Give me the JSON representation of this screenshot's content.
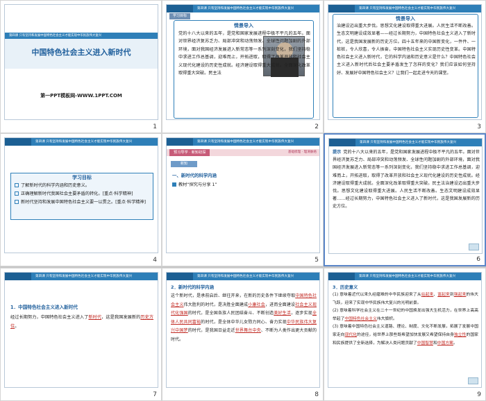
{
  "slides": [
    {
      "num": "1",
      "subtitle": "第四课 只有坚持和发展中国特色社会主义才能实现中华民族伟大复兴",
      "title": "中国特色社会主义进入新时代",
      "footer": "第一PPT模板网-WWW.1PPT.COM"
    },
    {
      "num": "2",
      "header": "第四课 只有坚持和发展中国特色社会主义才能实现中华民族伟大复兴",
      "section_tag": "学习目标",
      "box_title": "情景导入",
      "paragraph": "党的十八大以来的五年，是党和国家发展进程中极不平凡的五年。面对世界经济复苏乏力、局部冲突和动荡频发、全球性问题加剧的外部环境，面对我国经济发展进入新常态等一系列深刻变化，我们坚持稳中求进工作总基调，迎难而上，开拓进取，取得了改革开放和社会主义现代化建设的历史性成就。经济建设取得重大成就。全面深化改革取得重大突破。民主法"
    },
    {
      "num": "3",
      "header": "第四课 只有坚持和发展中国特色社会主义才能实现中华民族伟大复兴",
      "box_title": "情景导入",
      "paragraph": "治建设迈出重大步伐。思想文化建设取得重大进展。人民生活不断改善。生态文明建设成效显著——经过长期努力，中国特色社会主义进入了新时代，这是我国发展新的历史方位。四十五年来的中国新变化，一件件、一桩桩，令人欣喜，令人振奋，中国特色社会主义实现历史性变革。中国特色社会主义进入新时代，它的科学内涵和历史意义是什么？中国特色社会主义进入新时代后社会主要矛盾发生了怎样的变化？我们应该如何坚持好、发展好中国特色社会主义？让我们一起走进今天的课堂。"
    },
    {
      "num": "4",
      "header": "第四课 只有坚持和发展中国特色社会主义才能实现中华民族伟大复兴",
      "box_title": "学习目标",
      "items": [
        "了解新时代的科学内涵和历史意义。",
        "正确理解新时代我国社会主要矛盾的转化。[重点·科学精神]",
        "新时代坚持和发展中国特色社会主义要一以贯之。[重点·科学精神]"
      ]
    },
    {
      "num": "5",
      "header": "第四课 只有坚持和发展中国特色社会主义才能实现中华民族伟大复兴",
      "band": "预习导学 · 新知初探",
      "band_links": "基础梳理 · 理清脉络",
      "section": "新知",
      "point1": "一、新时代的科学内涵",
      "point2": "教材“探究与分享 1”"
    },
    {
      "num": "6",
      "header": "第四课 只有坚持和发展中国特色社会主义才能实现中华民族伟大复兴",
      "hint_label": "提示",
      "paragraph": "党的十八大以来的五年，是党和国家发展进程中极不平凡的五年。面对世界经济复苏乏力、局部冲突和动荡频发、全球性问题加剧的外部环境，面对我国经济发展进入新常态等一系列深刻变化，我们坚持稳中求进工作总基调，迎难而上，开拓进取，取得了改革开放和社会主义现代化建设的历史性成就。经济建设取得重大成就。全面深化改革取得重大突破。民主法治建设迈出重大步伐。思想文化建设取得重大进展。人民生活不断改善。生态文明建设成效显著……经过长期努力，中国特色社会主义进入了新时代，这是我国发展新的历史方位。"
    },
    {
      "num": "7",
      "header": "第四课 只有坚持和发展中国特色社会主义才能实现中华民族伟大复兴",
      "point_title": "1．中国特色社会主义进入新时代",
      "text_before": "经过长期努力，中国特色社会主义进入了",
      "blank1": "新时代",
      "text_mid": "，这是我国发展新的",
      "blank2": "历史方位",
      "text_after": "。"
    },
    {
      "num": "8",
      "header": "第四课 只有坚持和发展中国特色社会主义才能实现中华民族伟大复兴",
      "point_title": "2．新时代的科学内涵",
      "lead": "这个新时代，是承前启后、继往开来，在新的历史条件下继续夺取",
      "b1": "中国特色社会主义",
      "t1": "伟大胜利的时代，是决胜全面建成",
      "b2": "小康社会",
      "t2": "，进而全面建设",
      "b3": "社会主义现代化强国",
      "t3": "的时代，是全国各族人民团结奋斗、不断创造",
      "b4": "美好生活",
      "t4": "，逐步实现",
      "b5": "全体人民共同富裕",
      "t5": "的时代，是全体中华儿女勠力同心、奋力实现",
      "b6": "中华民族伟大复兴中国梦",
      "t6": "的时代，是我国日益走近",
      "b7": "世界舞台中央",
      "t7": "、不断为人类作出更大贡献的时代。"
    },
    {
      "num": "9",
      "header": "第四课 只有坚持和发展中国特色社会主义才能实现中华民族伟大复兴",
      "point_title": "3．历史意义",
      "l1a": "(1) 意味着近代以来久经磨难的中华民族迎来了从",
      "l1b1": "站起来",
      "l1b2": "富起来",
      "l1b3": "强起来",
      "l1c": "的伟大飞跃，迎来了实现中华民族伟大复兴的光明前景。",
      "l2": "(2) 意味着科学社会主义在二十一世纪的中国焕发出强大生机活力，在世界上高高举起了",
      "l2b": "中国特色社会主义",
      "l2c": "伟大旗帜。",
      "l3": "(3) 意味着中国特色社会主义道路、理论、制度、文化不断发展，拓展了发展中国家走向",
      "l3b": "现代化",
      "l3c": "的途径，给世界上那些既希望加快发展又希望保持自身",
      "l3d": "独立性",
      "l3e": "的国家和民族提供了全新选择，为解决人类问题贡献了",
      "l3f": "中国智慧",
      "l3g": "和",
      "l3h": "中国方案",
      "l3i": "。"
    }
  ],
  "colors": {
    "header_blue": "#2e7fb8",
    "accent_red": "#c0261f",
    "title_blue": "#1f5f9c"
  }
}
